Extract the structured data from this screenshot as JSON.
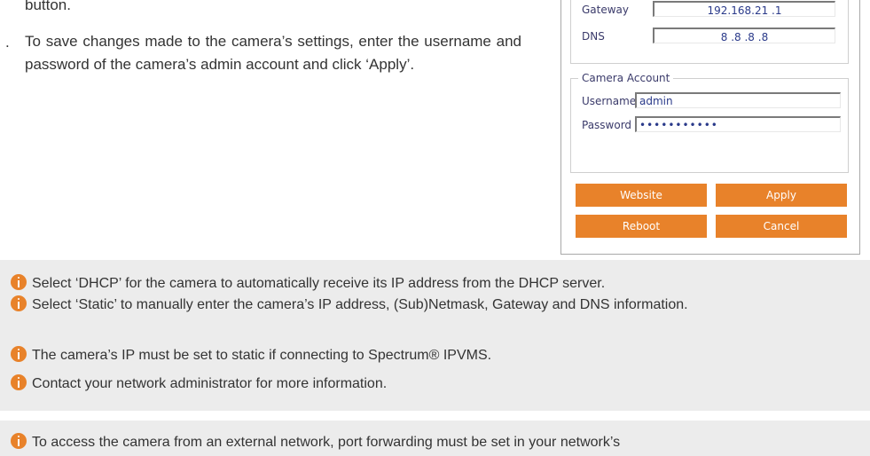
{
  "instructions": {
    "prev_tail": "button.",
    "step_marker": ".",
    "step_text": "To save changes made to the camera’s settings, enter the username and password of the camera’s admin account and click ‘Apply’."
  },
  "dialog": {
    "network": {
      "gateway_label": "Gateway",
      "gateway_value": "192.168.21 .1",
      "dns_label": "DNS",
      "dns_value": "8 .8 .8 .8"
    },
    "account": {
      "legend": "Camera Account",
      "username_label": "Username",
      "username_value": "admin",
      "password_label": "Password",
      "password_value": "•••••••••••"
    },
    "buttons": {
      "website": "Website",
      "apply": "Apply",
      "reboot": "Reboot",
      "cancel": "Cancel"
    }
  },
  "notes": {
    "group1": [
      "Select ‘DHCP’ for the camera to automatically receive its IP address from the DHCP server.",
      "Select ‘Static’ to manually enter the camera’s IP address, (Sub)Netmask, Gateway and DNS information.",
      "The camera’s IP must be set to static if connecting to Spectrum® IPVMS.",
      "Contact your network administrator for more information."
    ],
    "group2": [
      "To access the camera from an external network, port forwarding must be set in your network’s"
    ]
  },
  "colors": {
    "accent": "#e8822a",
    "note_bg": "#ececec"
  }
}
